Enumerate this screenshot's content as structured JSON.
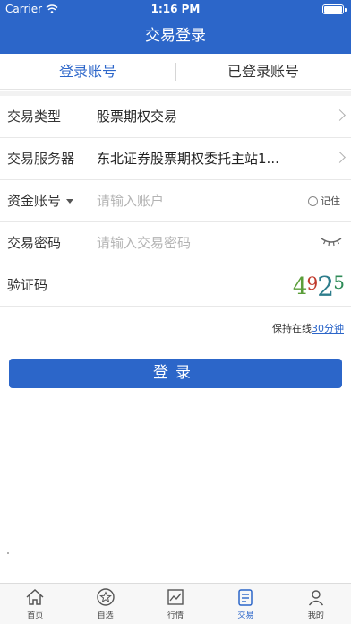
{
  "status_bar": {
    "carrier": "Carrier",
    "time": "1:16 PM",
    "battery_level": 1.0
  },
  "nav": {
    "title": "交易登录"
  },
  "tabs": [
    {
      "label": "登录账号",
      "active": true
    },
    {
      "label": "已登录账号",
      "active": false
    }
  ],
  "form": {
    "trade_type": {
      "label": "交易类型",
      "value": "股票期权交易"
    },
    "server": {
      "label": "交易服务器",
      "value": "东北证券股票期权委托主站1..."
    },
    "account": {
      "label": "资金账号",
      "placeholder": "请输入账户",
      "remember_label": "记住"
    },
    "password": {
      "label": "交易密码",
      "placeholder": "请输入交易密码"
    },
    "captcha": {
      "label": "验证码",
      "code": [
        "4",
        "9",
        "2",
        "5"
      ]
    }
  },
  "keep_online": {
    "prefix": "保持在线",
    "duration": "30分钟"
  },
  "login_button": "登录",
  "tabbar": [
    {
      "label": "首页",
      "icon": "home-icon",
      "active": false
    },
    {
      "label": "自选",
      "icon": "star-icon",
      "active": false
    },
    {
      "label": "行情",
      "icon": "chart-icon",
      "active": false
    },
    {
      "label": "交易",
      "icon": "trade-icon",
      "active": true
    },
    {
      "label": "我的",
      "icon": "user-icon",
      "active": false
    }
  ],
  "colors": {
    "primary": "#2c66c9",
    "captcha": [
      "#5b9e3a",
      "#c0392b",
      "#2e7d8c",
      "#2e8b57"
    ]
  }
}
